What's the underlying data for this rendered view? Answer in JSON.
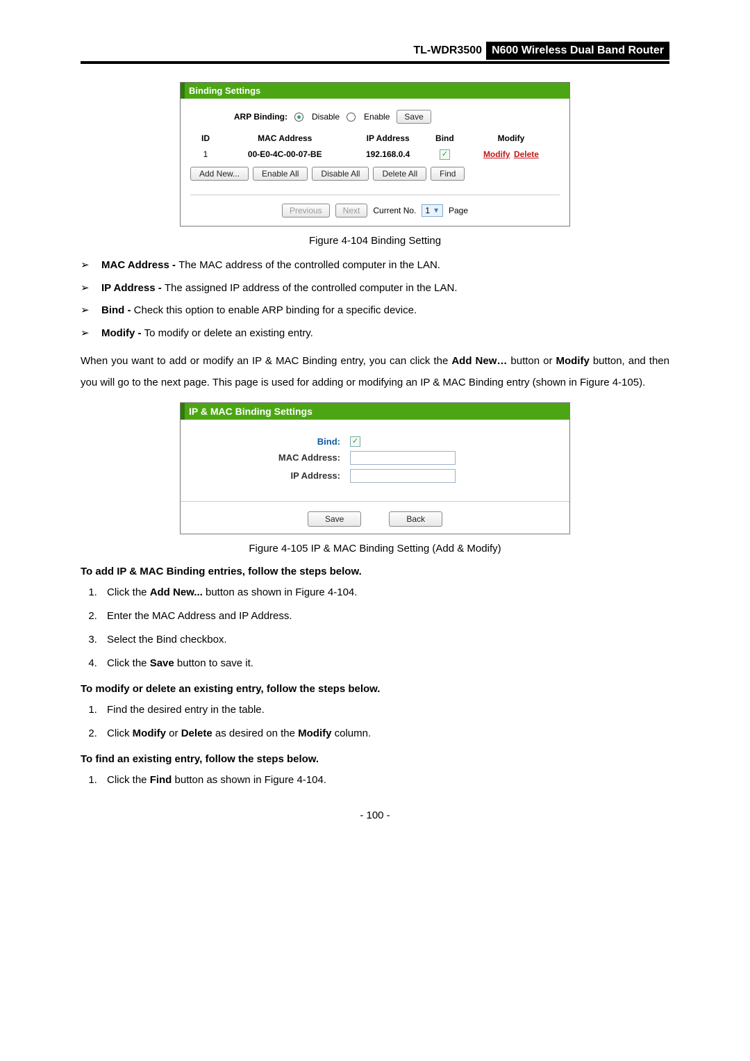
{
  "doc_header": {
    "model": "TL-WDR3500",
    "tag": "N600 Wireless Dual Band Router"
  },
  "panel1": {
    "title": "Binding Settings",
    "arp_label": "ARP Binding:",
    "radio_disable": "Disable",
    "radio_enable": "Enable",
    "save": "Save",
    "cols": {
      "id": "ID",
      "mac": "MAC Address",
      "ip": "IP Address",
      "bind": "Bind",
      "modify": "Modify"
    },
    "row": {
      "id": "1",
      "mac": "00-E0-4C-00-07-BE",
      "ip": "192.168.0.4",
      "modify": "Modify",
      "delete": "Delete"
    },
    "btns": {
      "add": "Add New...",
      "enable": "Enable All",
      "disable": "Disable All",
      "delete": "Delete All",
      "find": "Find"
    },
    "pager": {
      "prev": "Previous",
      "next": "Next",
      "current_lbl": "Current No.",
      "current_val": "1",
      "page_lbl": "Page"
    }
  },
  "caption1": "Figure 4-104 Binding Setting",
  "bullets": [
    {
      "term": "MAC Address - ",
      "desc": "The MAC address of the controlled computer in the LAN."
    },
    {
      "term": "IP Address - ",
      "desc": "The assigned IP address of the controlled computer in the LAN."
    },
    {
      "term": "Bind - ",
      "desc": "Check this option to enable ARP binding for a specific device."
    },
    {
      "term": "Modify - ",
      "desc": "To modify or delete an existing entry."
    }
  ],
  "para1_a": "When you want to add or modify an IP & MAC Binding entry, you can click the ",
  "para1_b": "Add New…",
  "para1_c": " button or ",
  "para1_d": "Modify",
  "para1_e": " button, and then you will go to the next page. This page is used for adding or modifying an IP & MAC Binding entry (shown in Figure 4-105).",
  "panel2": {
    "title": "IP & MAC Binding Settings",
    "bind_label": "Bind:",
    "mac_label": "MAC Address:",
    "ip_label": "IP Address:",
    "save": "Save",
    "back": "Back"
  },
  "caption2": "Figure 4-105 IP & MAC Binding Setting (Add & Modify)",
  "h_add": "To add IP & MAC Binding entries, follow the steps below.",
  "add_steps": [
    {
      "a": "Click the ",
      "b": "Add New...",
      "c": " button as shown in Figure 4-104."
    },
    {
      "a": "Enter the MAC Address and IP Address.",
      "b": "",
      "c": ""
    },
    {
      "a": "Select the Bind checkbox.",
      "b": "",
      "c": ""
    },
    {
      "a": "Click the ",
      "b": "Save",
      "c": " button to save it."
    }
  ],
  "h_mod": "To modify or delete an existing entry, follow the steps below.",
  "mod_steps": [
    {
      "a": "Find the desired entry in the table.",
      "b": "",
      "c": "",
      "d": "",
      "e": "",
      "f": ""
    },
    {
      "a": "Click ",
      "b": "Modify",
      "c": " or ",
      "d": "Delete",
      "e": " as desired on the ",
      "f": "Modify",
      "g": " column."
    }
  ],
  "h_find": "To find an existing entry, follow the steps below.",
  "find_steps": [
    {
      "a": "Click the ",
      "b": "Find",
      "c": " button as shown in Figure 4-104."
    }
  ],
  "page_number": "- 100 -"
}
